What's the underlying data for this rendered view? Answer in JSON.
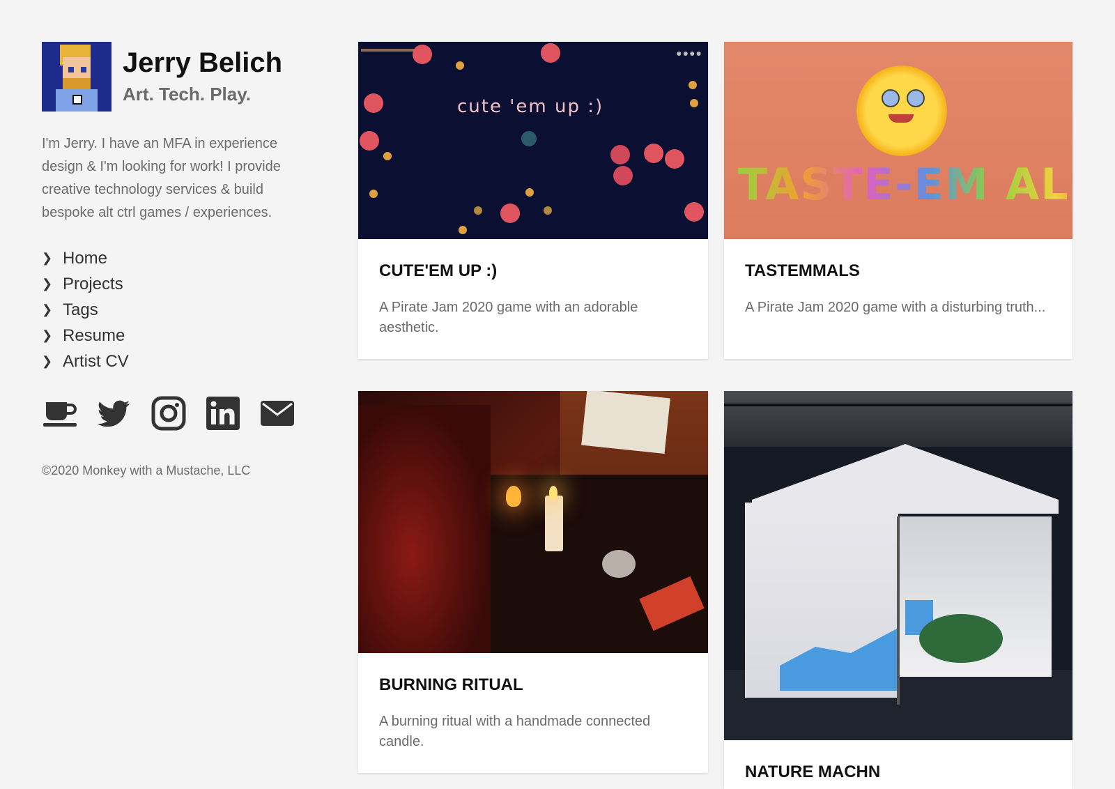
{
  "profile": {
    "name": "Jerry Belich",
    "tagline": "Art. Tech. Play.",
    "bio": "I'm Jerry. I have an MFA in experience design & I'm looking for work! I provide creative technology services & build bespoke alt ctrl games / experiences."
  },
  "nav": {
    "items": [
      {
        "label": "Home"
      },
      {
        "label": "Projects"
      },
      {
        "label": "Tags"
      },
      {
        "label": "Resume"
      },
      {
        "label": "Artist CV"
      }
    ]
  },
  "socials": [
    "coffee-cup-icon",
    "twitter-icon",
    "instagram-icon",
    "linkedin-icon",
    "mail-icon"
  ],
  "footer": {
    "copyright": "©2020 Monkey with a Mustache, LLC"
  },
  "cards": [
    {
      "title": "CUTE'EM UP :)",
      "desc": "A Pirate Jam 2020 game with an adorable aesthetic.",
      "thumb_text": "cute 'em up :)"
    },
    {
      "title": "TASTEMMALS",
      "desc": "A Pirate Jam 2020 game with a disturbing truth...",
      "thumb_text": "TASTE-EM ALL!"
    },
    {
      "title": "BURNING RITUAL",
      "desc": "A burning ritual with a handmade connected candle."
    },
    {
      "title": "NATURE MACHN"
    }
  ],
  "colors": {
    "background": "#f4f4f4",
    "card": "#ffffff",
    "text_dark": "#111111",
    "text_muted": "#6b6b6b",
    "icon": "#333333"
  }
}
